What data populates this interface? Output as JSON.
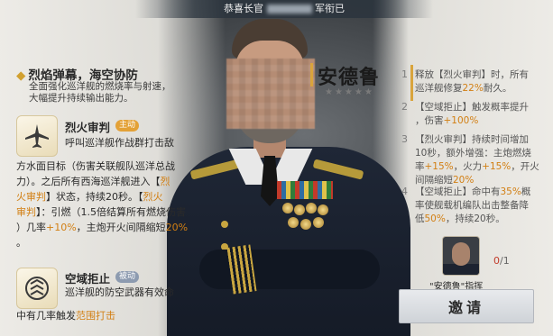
{
  "top_banner": {
    "left": "恭喜长官",
    "right": "军衔已"
  },
  "hero": {
    "name": "安德鲁",
    "stars": "★★★★★"
  },
  "fleet_skill": {
    "title": "烈焰弹幕，海空协防",
    "desc_line1": "全面强化巡洋舰的燃烧率与射速，",
    "desc_line2": "大幅提升持续输出能力。"
  },
  "skill_1": {
    "icon": "aircraft-icon",
    "title": "烈火审判",
    "tag": "主动",
    "line1": "呼叫巡洋舰作战群打击敌",
    "line2": "方水面目标（伤害关联舰队巡洋总战",
    "line3": "力）。之后所有西海巡洋舰进入【",
    "line3_hl": "烈",
    "line4_hl": "火审判",
    "line4": "】状态，持续20秒。【",
    "line4_hl2": "烈火",
    "line5_hl": "审判",
    "line5": "】：引燃（1.5倍结算所有燃烧伤害",
    "line6_a": "）几率",
    "line6_v": "+10%",
    "line6_b": "，主炮开火间隔缩短",
    "line6_v2": "20%",
    "line7": "。"
  },
  "skill_2": {
    "icon": "shield-icon",
    "title": "空域拒止",
    "tag": "被动",
    "line1": "巡洋舰的防空武器有效命",
    "line2": "中有几率触发",
    "line2_hl": "范围打击"
  },
  "talents": [
    {
      "num": "1",
      "a": "释放【烈火审判】时，所有",
      "b": "巡洋舰修复",
      "b_hl": "22%",
      "b_tail": "耐久。"
    },
    {
      "num": "2",
      "a": "【空域拒止】触发概率提升",
      "b": "，伤害",
      "b_hl": "+100%",
      "b_tail": ""
    },
    {
      "num": "3",
      "a": "【烈火审判】持续时间增加",
      "b": "10秒，额外增强：主炮燃烧",
      "c": "率",
      "c_hl": "+15%",
      "c_mid": "，火力",
      "c_hl2": "+15%",
      "c_tail": "，开火",
      "d": "间隔缩短",
      "d_hl": "20%"
    },
    {
      "num": "4",
      "a": "【空域拒止】命中有",
      "a_hl": "35%",
      "a_tail": "概",
      "b": "率使舰载机编队出击整备降",
      "c": "低",
      "c_hl": "50%",
      "c_tail": "，持续20秒。"
    }
  ],
  "recruit": {
    "count_have": "0",
    "count_sep": "/1",
    "caption": "\"安德鲁\"指挥",
    "invite_label": "邀请"
  }
}
